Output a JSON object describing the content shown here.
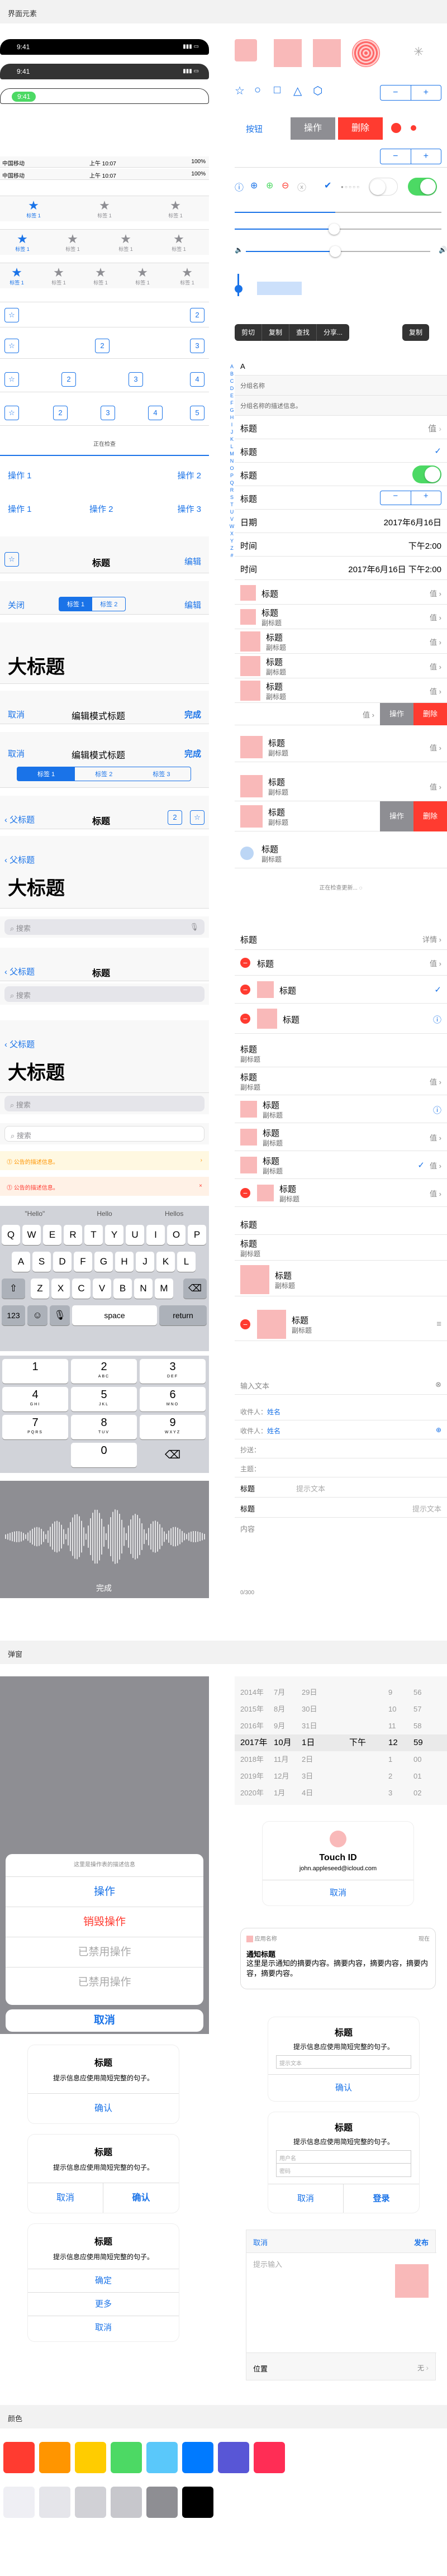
{
  "sections": {
    "ui": "界面元素",
    "popups": "弹窗",
    "colors": "颜色"
  },
  "status": {
    "time": "9:41",
    "time2": "上午 10:07",
    "battery": "100%",
    "carrier": "中国移动"
  },
  "buttons": {
    "primary": "按钮",
    "op": "操作",
    "del": "删除",
    "minus": "−",
    "plus": "+"
  },
  "tabs": {
    "label": "标签 1"
  },
  "segments": [
    "标签 1",
    "标签 2",
    "标签 3"
  ],
  "nav": {
    "title": "标题",
    "edit": "编辑",
    "done": "完成",
    "cancel": "取消",
    "close": "关闭",
    "back": "父标题",
    "large": "大标题",
    "editmode": "编辑模式标题",
    "loading": "正在检查",
    "search": "搜索"
  },
  "actions": {
    "a1": "操作 1",
    "a2": "操作 2",
    "a3": "操作 3"
  },
  "menu": [
    "剪切",
    "复制",
    "查找",
    "分享..."
  ],
  "index": [
    "A",
    "B",
    "C",
    "D",
    "E",
    "F",
    "G",
    "H",
    "I",
    "J",
    "K",
    "L",
    "M",
    "N",
    "O",
    "P",
    "Q",
    "R",
    "S",
    "T",
    "U",
    "V",
    "W",
    "X",
    "Y",
    "Z",
    "#"
  ],
  "list": {
    "groupTitle": "分组名称",
    "groupNote": "分组名称的描述信息。",
    "title": "标题",
    "sub": "副标题",
    "value": "值",
    "date": "日期",
    "dateVal": "2017年6月16日",
    "time": "时间",
    "timeVal": "下午2:00",
    "timeFull": "2017年6月16日 下午2:00",
    "detail": "详情",
    "pull": "正在检查更新..."
  },
  "notes": {
    "note1": "公告的描述信息。",
    "note2": "公告的描述信息。"
  },
  "keyboard": {
    "sugg": [
      "\"Hello\"",
      "Hello",
      "Hellos"
    ],
    "r1": [
      "Q",
      "W",
      "E",
      "R",
      "T",
      "Y",
      "U",
      "I",
      "O",
      "P"
    ],
    "r2": [
      "A",
      "S",
      "D",
      "F",
      "G",
      "H",
      "J",
      "K",
      "L"
    ],
    "r3": [
      "Z",
      "X",
      "C",
      "V",
      "B",
      "N",
      "M"
    ],
    "num": "123",
    "space": "space",
    "ret": "return"
  },
  "numpad": [
    {
      "n": "1",
      "l": ""
    },
    {
      "n": "2",
      "l": "ABC"
    },
    {
      "n": "3",
      "l": "DEF"
    },
    {
      "n": "4",
      "l": "GHI"
    },
    {
      "n": "5",
      "l": "JKL"
    },
    {
      "n": "6",
      "l": "MNO"
    },
    {
      "n": "7",
      "l": "PQRS"
    },
    {
      "n": "8",
      "l": "TUV"
    },
    {
      "n": "9",
      "l": "WXYZ"
    },
    {
      "n": "0",
      "l": ""
    }
  ],
  "voice": {
    "done": "完成"
  },
  "compose": {
    "placeholder": "输入文本",
    "to": "收件人：",
    "name": "姓名",
    "cc": "抄送：",
    "subject": "主题：",
    "titleLabel": "标题",
    "textPh": "提示文本",
    "content": "内容",
    "count": "0/300"
  },
  "sheet": {
    "desc": "这里是操作表的描述信息",
    "action": "操作",
    "destroy": "销毁操作",
    "disabled": "已禁用操作",
    "cancel": "取消"
  },
  "alert": {
    "title": "标题",
    "msg": "提示信息应使用简短完整的句子。",
    "ok": "确认",
    "cancel": "取消",
    "confirm": "确定",
    "more": "更多",
    "login": "登录",
    "inputPh": "提示文本",
    "user": "用户名",
    "pwd": "密码"
  },
  "picker": {
    "rows": [
      [
        "2014年",
        "7月",
        "29日",
        "",
        "9",
        "56"
      ],
      [
        "2015年",
        "8月",
        "30日",
        "",
        "10",
        "57"
      ],
      [
        "2016年",
        "9月",
        "31日",
        "",
        "11",
        "58"
      ],
      [
        "2017年",
        "10月",
        "1日",
        "下午",
        "12",
        "59"
      ],
      [
        "2018年",
        "11月",
        "2日",
        "",
        "1",
        "00"
      ],
      [
        "2019年",
        "12月",
        "3日",
        "",
        "2",
        "01"
      ],
      [
        "2020年",
        "1月",
        "4日",
        "",
        "3",
        "02"
      ]
    ]
  },
  "touch": {
    "title": "Touch ID",
    "mail": "john.appleseed@icloud.com",
    "cancel": "取消"
  },
  "notif": {
    "app": "应用名称",
    "ago": "现在",
    "title": "通知标题",
    "body": "这里是示通知的摘要内容。摘要内容，摘要内容，摘要内容，摘要内容。"
  },
  "share": {
    "cancel": "取消",
    "post": "发布",
    "ph": "提示输入",
    "loc": "位置",
    "none": "无"
  },
  "colors": {
    "row1": [
      "#ff3b30",
      "#ff9500",
      "#ffcc00",
      "#4cd964",
      "#5ac8fa",
      "#007aff",
      "#5856d6",
      "#ff2d55"
    ],
    "row2": [
      "#efeff4",
      "#e5e5ea",
      "#d1d1d6",
      "#c7c7cc",
      "#8e8e93",
      "#000000"
    ]
  }
}
